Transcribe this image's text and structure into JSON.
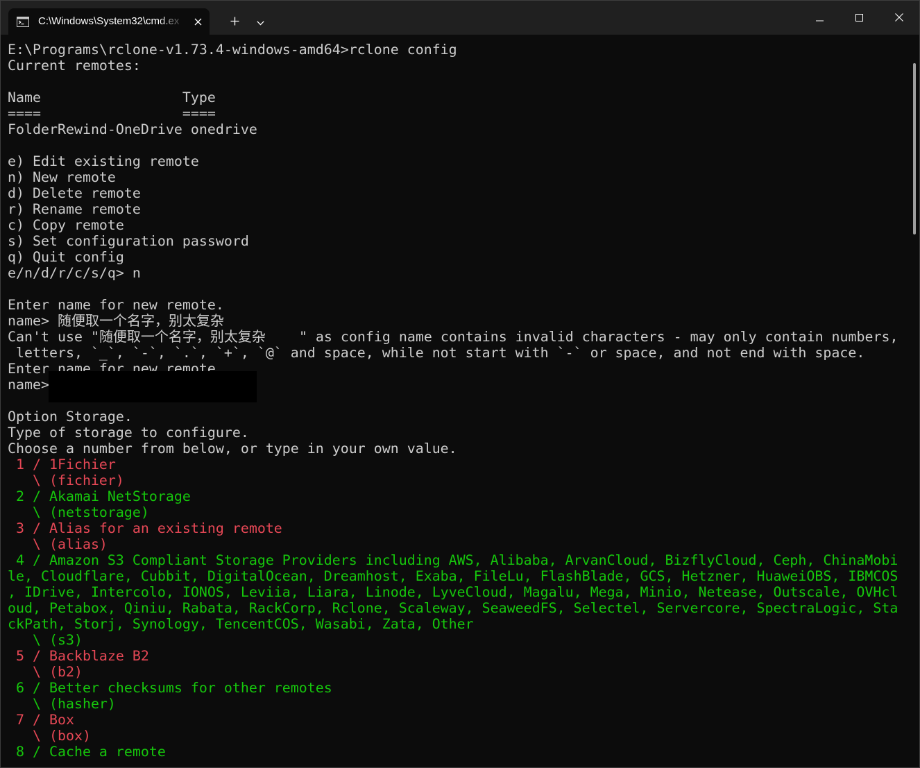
{
  "titlebar": {
    "tab_icon": "cmd-icon",
    "tab_title": "C:\\Windows\\System32\\cmd.ex",
    "tab_close_icon": "close-icon",
    "new_tab_icon": "plus-icon",
    "tab_menu_icon": "chevron-down-icon",
    "minimize_icon": "minimize-icon",
    "maximize_icon": "maximize-icon",
    "close_icon": "close-icon"
  },
  "colors": {
    "titlebar_background": "#202020",
    "terminal_background": "#0c0c0c",
    "text": "#cccccc",
    "red": "#e74856",
    "green": "#16c60c",
    "redaction": "#000000"
  },
  "terminal": {
    "command": "E:\\Programs\\rclone-v1.73.4-windows-amd64>rclone config",
    "remotes": {
      "heading": "Current remotes:",
      "header": "Name                 Type",
      "rule": "====                 ====",
      "rows": [
        "FolderRewind-OneDrive onedrive"
      ]
    },
    "menu": {
      "items": [
        "e) Edit existing remote",
        "n) New remote",
        "d) Delete remote",
        "r) Rename remote",
        "c) Copy remote",
        "s) Set configuration password",
        "q) Quit config"
      ],
      "prompt": "e/n/d/r/c/s/q> n"
    },
    "name_step": {
      "instruction": "Enter name for new remote.",
      "prompt": "name>",
      "entered_value": "随便取一个名字，别太复杂",
      "error_prefix": "Can't use \"",
      "error_name": "随便取一个名字，别太复杂",
      "error_suffix": "\" as config name contains invalid characters - may only contain numbers,",
      "error_continuation": " letters, `_`, `-`, `.`, `+`, `@` and space, while not start with `-` or space, and not end with space.",
      "retry_instruction": "Enter name for new remote.",
      "retry_prompt": "name>"
    },
    "storage_step": {
      "heading": "Option Storage.",
      "description": "Type of storage to configure.",
      "instruction": "Choose a number from below, or type in your own value.",
      "options": [
        {
          "lines": [
            " 1 / 1Fichier"
          ],
          "backend": "   \\ (fichier)",
          "color": "red"
        },
        {
          "lines": [
            " 2 / Akamai NetStorage"
          ],
          "backend": "   \\ (netstorage)",
          "color": "green"
        },
        {
          "lines": [
            " 3 / Alias for an existing remote"
          ],
          "backend": "   \\ (alias)",
          "color": "red"
        },
        {
          "lines": [
            " 4 / Amazon S3 Compliant Storage Providers including AWS, Alibaba, ArvanCloud, BizflyCloud, Ceph, ChinaMobi",
            "le, Cloudflare, Cubbit, DigitalOcean, Dreamhost, Exaba, FileLu, FlashBlade, GCS, Hetzner, HuaweiOBS, IBMCOS",
            ", IDrive, Intercolo, IONOS, Leviia, Liara, Linode, LyveCloud, Magalu, Mega, Minio, Netease, Outscale, OVHcl",
            "oud, Petabox, Qiniu, Rabata, RackCorp, Rclone, Scaleway, SeaweedFS, Selectel, Servercore, SpectraLogic, Sta",
            "ckPath, Storj, Synology, TencentCOS, Wasabi, Zata, Other"
          ],
          "backend": "   \\ (s3)",
          "color": "green"
        },
        {
          "lines": [
            " 5 / Backblaze B2"
          ],
          "backend": "   \\ (b2)",
          "color": "red"
        },
        {
          "lines": [
            " 6 / Better checksums for other remotes"
          ],
          "backend": "   \\ (hasher)",
          "color": "green"
        },
        {
          "lines": [
            " 7 / Box"
          ],
          "backend": "   \\ (box)",
          "color": "red"
        },
        {
          "lines": [
            " 8 / Cache a remote"
          ],
          "color": "green"
        }
      ]
    }
  }
}
